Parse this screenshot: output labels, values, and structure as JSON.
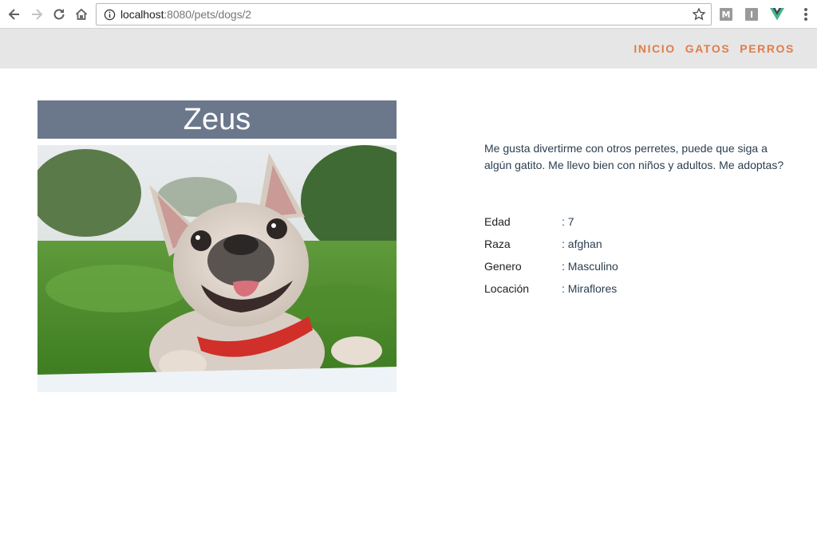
{
  "browser": {
    "url_host": "localhost",
    "url_rest": ":8080/pets/dogs/2",
    "extensions": [
      "M",
      "I"
    ]
  },
  "nav": {
    "items": [
      "INICIO",
      "GATOS",
      "PERROS"
    ],
    "accent": "#e07c49"
  },
  "pet": {
    "name": "Zeus",
    "description": "Me gusta divertirme con otros perretes, puede que siga a algún gatito. Me llevo bien con niños y adultos. Me adoptas?",
    "details": [
      {
        "label": "Edad",
        "value": ": 7"
      },
      {
        "label": "Raza",
        "value": ": afghan"
      },
      {
        "label": "Genero",
        "value": ": Masculino"
      },
      {
        "label": "Locación",
        "value": ": Miraflores"
      }
    ]
  },
  "colors": {
    "title_bar": "#6b788c",
    "header_bg": "#e6e6e6"
  }
}
